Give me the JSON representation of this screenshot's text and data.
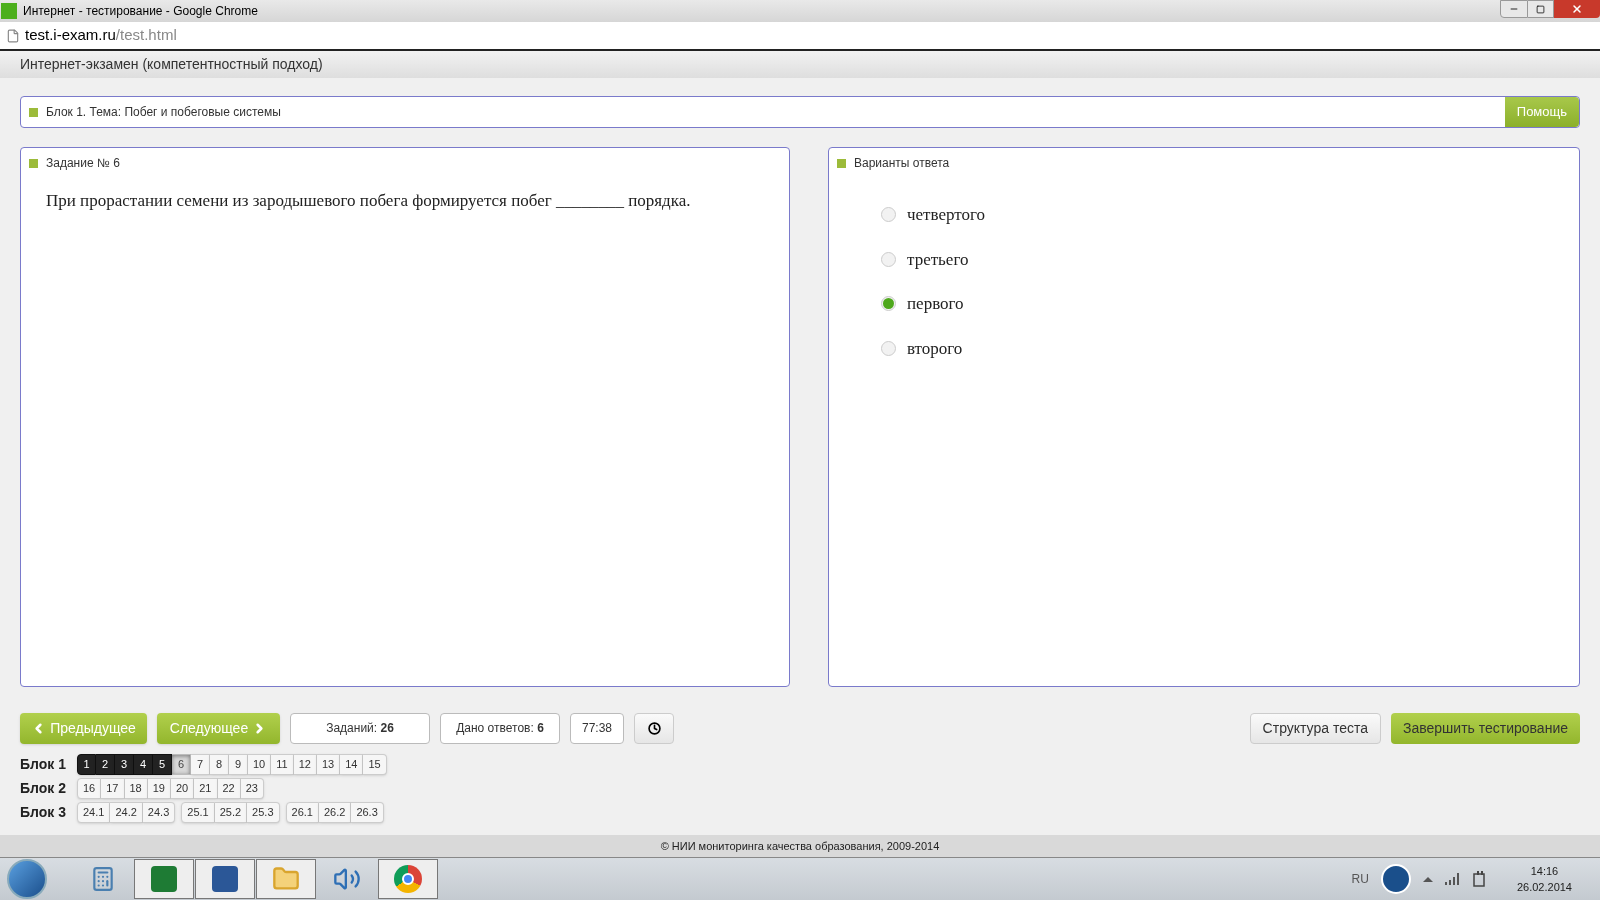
{
  "window": {
    "title": "Интернет - тестирование - Google Chrome"
  },
  "address_bar": {
    "host": "test.i-exam.ru",
    "path": "/test.html"
  },
  "header": {
    "title": "Интернет-экзамен (компетентностный подход)"
  },
  "topic": {
    "text": "Блок 1. Тема: Побег и побеговые системы",
    "help_button": "Помощь"
  },
  "task": {
    "title": "Задание № 6",
    "question": "При прорастании семени из зародышевого побега формируется побег ________ порядка."
  },
  "answers": {
    "title": "Варианты ответа",
    "options": [
      {
        "label": "четвертого",
        "selected": false
      },
      {
        "label": "третьего",
        "selected": false
      },
      {
        "label": "первого",
        "selected": true
      },
      {
        "label": "второго",
        "selected": false
      }
    ]
  },
  "nav": {
    "prev": "Предыдущее",
    "next": "Следующее",
    "tasks_label": "Заданий:",
    "tasks_count": "26",
    "answered_label": "Дано ответов:",
    "answered_count": "6",
    "timer": "77:38",
    "structure": "Структура теста",
    "finish": "Завершить тестирование"
  },
  "blocks": [
    {
      "label": "Блок 1",
      "groups": [
        [
          {
            "n": "1",
            "answered": true,
            "selected": false
          },
          {
            "n": "2",
            "answered": true,
            "selected": false
          },
          {
            "n": "3",
            "answered": true,
            "selected": false
          },
          {
            "n": "4",
            "answered": true,
            "selected": false
          },
          {
            "n": "5",
            "answered": true,
            "selected": false
          },
          {
            "n": "6",
            "answered": false,
            "selected": true
          },
          {
            "n": "7",
            "answered": false,
            "selected": false
          },
          {
            "n": "8",
            "answered": false,
            "selected": false
          },
          {
            "n": "9",
            "answered": false,
            "selected": false
          },
          {
            "n": "10",
            "answered": false,
            "selected": false
          },
          {
            "n": "11",
            "answered": false,
            "selected": false
          },
          {
            "n": "12",
            "answered": false,
            "selected": false
          },
          {
            "n": "13",
            "answered": false,
            "selected": false
          },
          {
            "n": "14",
            "answered": false,
            "selected": false
          },
          {
            "n": "15",
            "answered": false,
            "selected": false
          }
        ]
      ]
    },
    {
      "label": "Блок 2",
      "groups": [
        [
          {
            "n": "16",
            "answered": false,
            "selected": false
          },
          {
            "n": "17",
            "answered": false,
            "selected": false
          },
          {
            "n": "18",
            "answered": false,
            "selected": false
          },
          {
            "n": "19",
            "answered": false,
            "selected": false
          },
          {
            "n": "20",
            "answered": false,
            "selected": false
          },
          {
            "n": "21",
            "answered": false,
            "selected": false
          },
          {
            "n": "22",
            "answered": false,
            "selected": false
          },
          {
            "n": "23",
            "answered": false,
            "selected": false
          }
        ]
      ]
    },
    {
      "label": "Блок 3",
      "groups": [
        [
          {
            "n": "24.1",
            "answered": false,
            "selected": false
          },
          {
            "n": "24.2",
            "answered": false,
            "selected": false
          },
          {
            "n": "24.3",
            "answered": false,
            "selected": false
          }
        ],
        [
          {
            "n": "25.1",
            "answered": false,
            "selected": false
          },
          {
            "n": "25.2",
            "answered": false,
            "selected": false
          },
          {
            "n": "25.3",
            "answered": false,
            "selected": false
          }
        ],
        [
          {
            "n": "26.1",
            "answered": false,
            "selected": false
          },
          {
            "n": "26.2",
            "answered": false,
            "selected": false
          },
          {
            "n": "26.3",
            "answered": false,
            "selected": false
          }
        ]
      ]
    }
  ],
  "footer": "© НИИ мониторинга качества образования, 2009-2014",
  "taskbar": {
    "language": "RU",
    "time": "14:16",
    "date": "26.02.2014"
  }
}
